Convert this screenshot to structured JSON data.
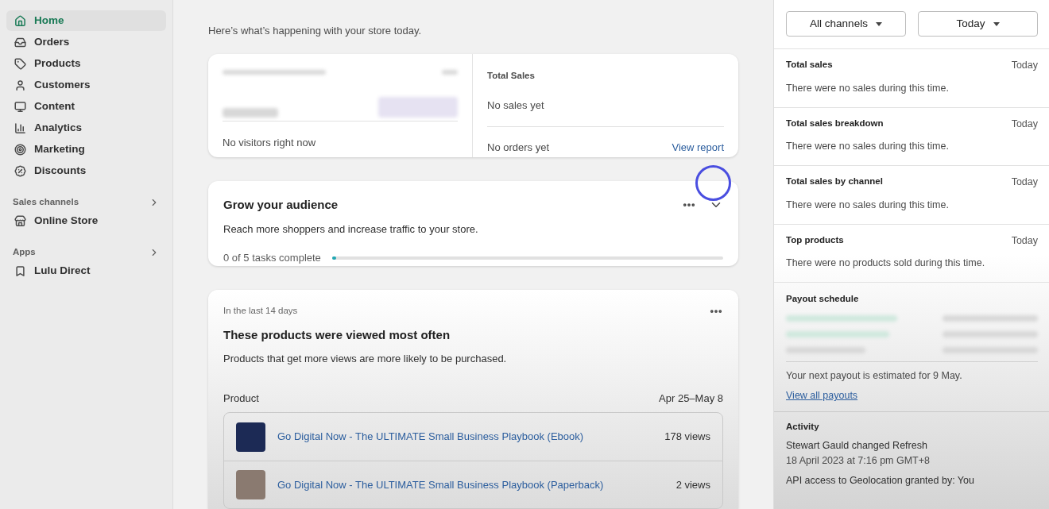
{
  "sidebar": {
    "items": [
      {
        "label": "Home",
        "kind": "home",
        "selected": true
      },
      {
        "label": "Orders",
        "kind": "orders",
        "selected": false
      },
      {
        "label": "Products",
        "kind": "tag",
        "selected": false
      },
      {
        "label": "Customers",
        "kind": "person",
        "selected": false
      },
      {
        "label": "Content",
        "kind": "content",
        "selected": false
      },
      {
        "label": "Analytics",
        "kind": "chart",
        "selected": false
      },
      {
        "label": "Marketing",
        "kind": "target",
        "selected": false
      },
      {
        "label": "Discounts",
        "kind": "discount",
        "selected": false
      }
    ],
    "sections": [
      {
        "title": "Sales channels",
        "items": [
          {
            "label": "Online Store",
            "kind": "store",
            "selected": false
          }
        ]
      },
      {
        "title": "Apps",
        "items": [
          {
            "label": "Lulu Direct",
            "kind": "app",
            "selected": false
          }
        ]
      }
    ]
  },
  "main": {
    "intro": "Here’s what’s happening with your store today.",
    "summary": {
      "visitors": "No visitors right now",
      "sales_title": "Total Sales",
      "sales": "No sales yet",
      "orders": "No orders yet",
      "link": "View report"
    },
    "grow": {
      "title": "Grow your audience",
      "description": "Reach more shoppers and increase traffic to your store.",
      "progress_text": "0 of 5 tasks complete",
      "level": 0.01
    },
    "products": {
      "period": "In the last 14 days",
      "title": "These products were viewed most often",
      "subtitle": "Products that get more views are more likely to be purchased.",
      "columns": [
        "Product",
        "Apr 25–May 8"
      ],
      "rows": [
        {
          "name": "Go Digital Now - The ULTIMATE Small Business Playbook (Ebook)",
          "views": "178 views"
        },
        {
          "name": "Go Digital Now - The ULTIMATE Small Business Playbook (Paperback)",
          "views": "2 views"
        }
      ]
    }
  },
  "right": {
    "filters": [
      "All channels",
      "Today"
    ],
    "reports": [
      {
        "title": "Total sales",
        "period": "Today",
        "message": "There were no sales during this time."
      },
      {
        "title": "Total sales breakdown",
        "period": "Today",
        "message": "There were no sales during this time."
      },
      {
        "title": "Total sales by channel",
        "period": "Today",
        "message": "There were no sales during this time."
      },
      {
        "title": "Top products",
        "period": "Today",
        "message": "There were no products sold during this time."
      }
    ],
    "payout": {
      "title": "Payout schedule",
      "message": "Your next payout is estimated for 9 May.",
      "link": "View all payouts"
    },
    "activity": {
      "title": "Activity",
      "items": [
        {
          "text": "Stewart Gauld changed Refresh",
          "time": "18 April 2023 at 7:16 pm GMT+8"
        },
        {
          "text": "API access to Geolocation granted by: You"
        }
      ]
    }
  }
}
